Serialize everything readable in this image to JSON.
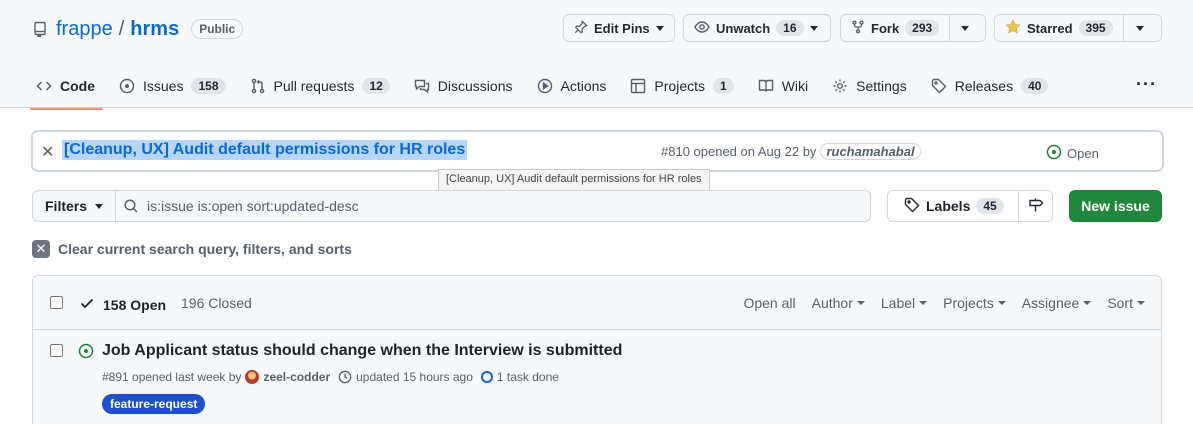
{
  "repo": {
    "owner": "frappe",
    "separator": "/",
    "name": "hrms",
    "visibility": "Public"
  },
  "header_buttons": {
    "edit_pins": "Edit Pins",
    "unwatch": "Unwatch",
    "unwatch_count": "16",
    "fork": "Fork",
    "fork_count": "293",
    "starred": "Starred",
    "star_count": "395"
  },
  "nav": {
    "code": "Code",
    "issues": "Issues",
    "issues_count": "158",
    "pull_requests": "Pull requests",
    "pull_requests_count": "12",
    "discussions": "Discussions",
    "actions": "Actions",
    "projects": "Projects",
    "projects_count": "1",
    "wiki": "Wiki",
    "settings": "Settings",
    "releases": "Releases",
    "releases_count": "40",
    "more": "···"
  },
  "pinned_issue": {
    "title": "[Cleanup, UX] Audit default permissions for HR roles",
    "number_text": "#810 opened on Aug 22 by",
    "author": "ruchamahabal",
    "status": "Open",
    "tooltip": "[Cleanup, UX] Audit default permissions for HR roles"
  },
  "filter_bar": {
    "filters_label": "Filters",
    "query": "is:issue is:open sort:updated-desc",
    "labels_label": "Labels",
    "labels_count": "45",
    "new_issue_label": "New issue"
  },
  "clear_query": "Clear current search query, filters, and sorts",
  "issues_header": {
    "open_label": "158 Open",
    "closed_label": "196 Closed",
    "open_all": "Open all",
    "author": "Author",
    "label": "Label",
    "projects": "Projects",
    "assignee": "Assignee",
    "sort": "Sort"
  },
  "issues": [
    {
      "title": "Job Applicant status should change when the Interview is submitted",
      "number_text": "#891 opened last week by",
      "author": "zeel-codder",
      "updated": "updated 15 hours ago",
      "tasks": "1 task done",
      "label": "feature-request"
    }
  ],
  "colors": {
    "link": "#0969da",
    "open_green": "#1a7f37",
    "primary_button": "#1f883d",
    "nav_underline": "#fd8c73",
    "label_chip": "#1f4fd1"
  }
}
